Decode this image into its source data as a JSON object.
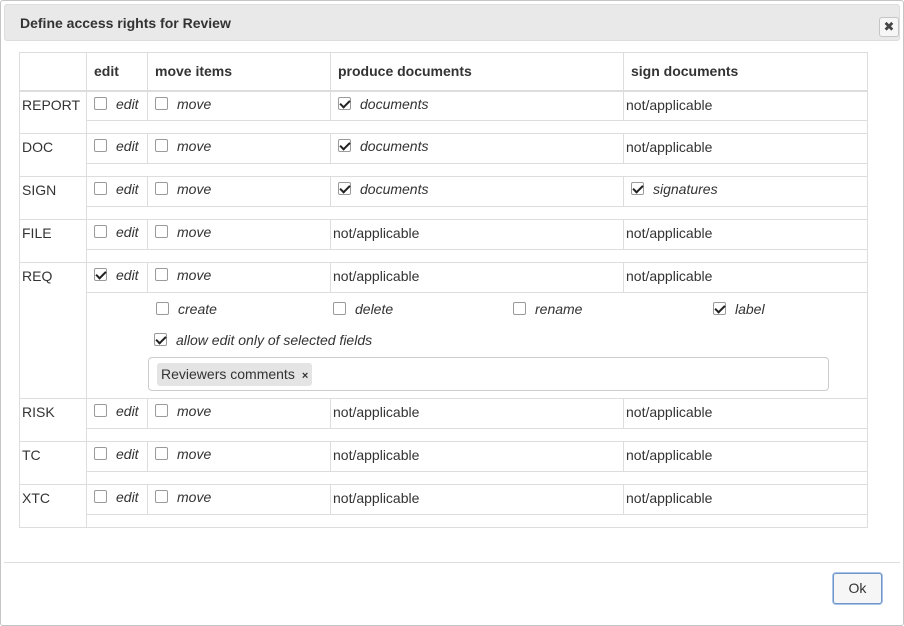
{
  "dialog": {
    "title": "Define access rights for Review",
    "close_icon": "close-x-icon",
    "ok_label": "Ok"
  },
  "columns": {
    "edit": "edit",
    "move": "move items",
    "produce": "produce documents",
    "sign": "sign documents"
  },
  "labels": {
    "edit": "edit",
    "move": "move",
    "documents": "documents",
    "signatures": "signatures",
    "not_applicable": "not/applicable"
  },
  "rows": [
    {
      "name": "REPORT",
      "edit": false,
      "move": false,
      "produce": true,
      "sign": null
    },
    {
      "name": "DOC",
      "edit": false,
      "move": false,
      "produce": true,
      "sign": null
    },
    {
      "name": "SIGN",
      "edit": false,
      "move": false,
      "produce": true,
      "sign": true
    },
    {
      "name": "FILE",
      "edit": false,
      "move": false,
      "produce": null,
      "sign": null
    },
    {
      "name": "REQ",
      "edit": true,
      "move": false,
      "produce": null,
      "sign": null
    },
    {
      "name": "RISK",
      "edit": false,
      "move": false,
      "produce": null,
      "sign": null
    },
    {
      "name": "TC",
      "edit": false,
      "move": false,
      "produce": null,
      "sign": null
    },
    {
      "name": "XTC",
      "edit": false,
      "move": false,
      "produce": null,
      "sign": null
    }
  ],
  "req_options": {
    "create": {
      "label": "create",
      "checked": false
    },
    "delete": {
      "label": "delete",
      "checked": false
    },
    "rename": {
      "label": "rename",
      "checked": false
    },
    "label": {
      "label": "label",
      "checked": true
    },
    "allow_fields": {
      "label": "allow edit only of selected fields",
      "checked": true
    },
    "selected_fields": [
      "Reviewers comments"
    ],
    "tag_remove_glyph": "×"
  }
}
